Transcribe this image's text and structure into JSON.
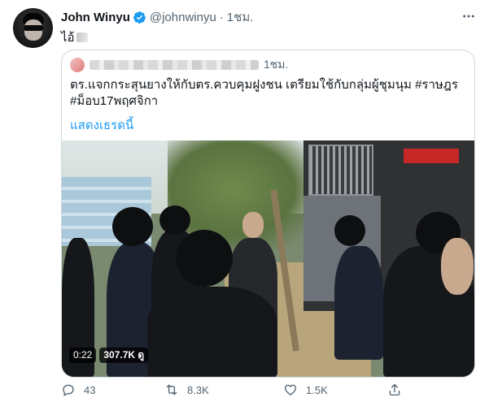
{
  "tweet": {
    "author_name": "John Winyu",
    "handle": "@johnwinyu",
    "separator": "·",
    "time": "1ชม.",
    "text": "ไอ้",
    "more_icon": "more-horizontal-icon"
  },
  "quote": {
    "time": "1ชม.",
    "text": "ตร.แจกกระสุนยางให้กับตร.ควบคุมฝูงชน เตรียมใช้กับกลุ่มผู้ชุมนุม #ราษฎร #ม็อบ17พฤศจิกา",
    "show_thread": "แสดงเธรดนี้",
    "video": {
      "duration": "0:22",
      "views": "307.7K ดู"
    }
  },
  "actions": {
    "replies": "43",
    "retweets": "8.3K",
    "likes": "1.5K"
  },
  "colors": {
    "accent": "#1d9bf0",
    "secondary_text": "#536471",
    "border": "#cfd9de"
  }
}
